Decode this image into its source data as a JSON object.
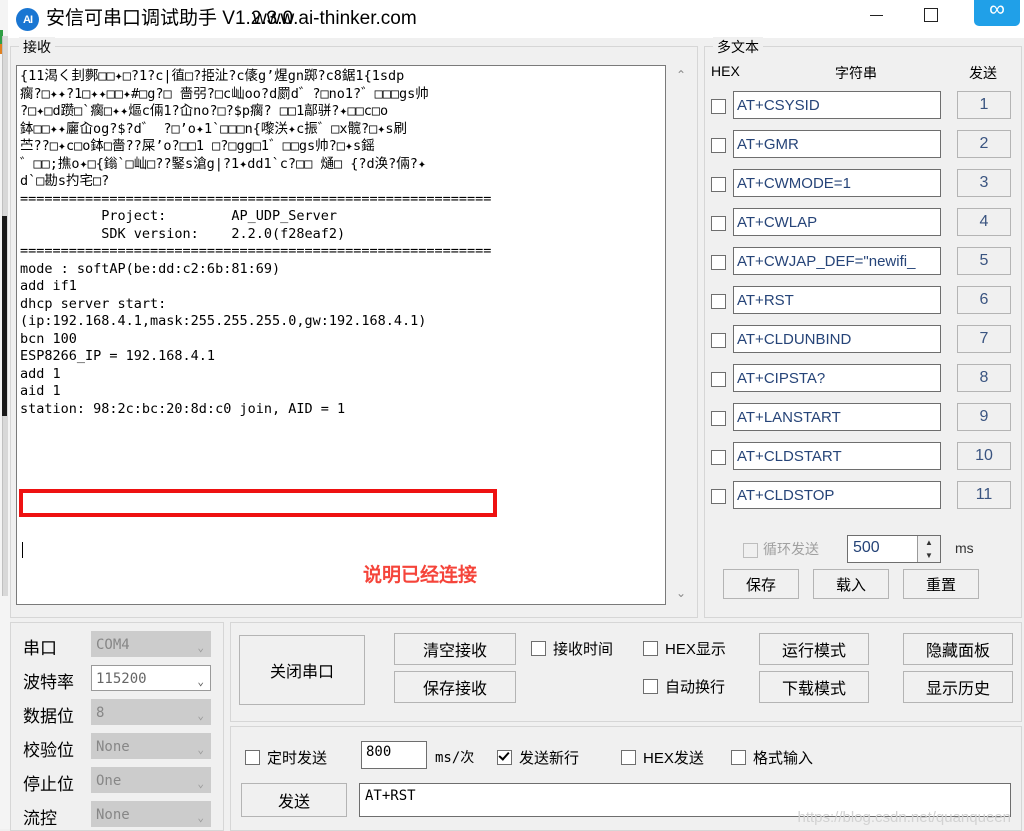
{
  "window": {
    "logo_text": "AI",
    "title": "安信可串口调试助手 V1.2.3.0",
    "url": "www.ai-thinker.com",
    "minimize": "—",
    "maximize": "",
    "close": "✕",
    "badge": "∞"
  },
  "receive": {
    "group_title": "接收",
    "text": "{11渴く刲鄸□□✦□?1?c|徝□?挋沚?c㒅g’煋gn踯?c8鋸1{1sdp\n瘸?□✦✦?1□✦✦□□✦#□g?□ 嗇弜?□c屾oo?d罽d゛?□no1?゛□□□gs帅\n?□✦□d躜□`瘸□✦✦熰c倆1?屳no?□?$p瘸? □□1鄗骈?✦□□c□o\n鉢□□✦✦廲屳og?$?d゛ ?□’o✦1`□□□n{嚟浂✦c振゛□x髋?□✦s刷\n苎??□✦c□o鉢□嗇??屎’o?□□1 □?□gg□1゛□□gs帅?□✦s鎐\n゛□□;撨o✦□{鎓`□屾□??鋻s滄g|?1✦dd1`c?□□ 熥□ {?d涣?倆?✦\nd`□勘s扚宅□?",
    "console": [
      "==========================================================",
      "          Project:        AP_UDP_Server",
      "          SDK version:    2.2.0(f28eaf2)",
      "==========================================================",
      "mode : softAP(be:dd:c2:6b:81:69)",
      "add if1",
      "dhcp server start:",
      "(ip:192.168.4.1,mask:255.255.255.0,gw:192.168.4.1)",
      "bcn 100",
      "ESP8266_IP = 192.168.4.1",
      "add 1",
      "aid 1",
      "station: 98:2c:bc:20:8d:c0 join, AID = 1"
    ],
    "annotation": "说明已经连接",
    "annotation_color": "#f5443a",
    "highlight_color": "#ee1111",
    "scroll_up": "⌃",
    "scroll_down": "⌄"
  },
  "multitext": {
    "group_title": "多文本",
    "col_hex": "HEX",
    "col_string": "字符串",
    "col_send": "发送",
    "rows": [
      {
        "hex_checked": false,
        "command": "AT+CSYSID",
        "send": "1"
      },
      {
        "hex_checked": false,
        "command": "AT+GMR",
        "send": "2"
      },
      {
        "hex_checked": false,
        "command": "AT+CWMODE=1",
        "send": "3"
      },
      {
        "hex_checked": false,
        "command": "AT+CWLAP",
        "send": "4"
      },
      {
        "hex_checked": false,
        "command": "AT+CWJAP_DEF=\"newifi_",
        "send": "5"
      },
      {
        "hex_checked": false,
        "command": "AT+RST",
        "send": "6"
      },
      {
        "hex_checked": false,
        "command": "AT+CLDUNBIND",
        "send": "7"
      },
      {
        "hex_checked": false,
        "command": "AT+CIPSTA?",
        "send": "8"
      },
      {
        "hex_checked": false,
        "command": "AT+LANSTART",
        "send": "9"
      },
      {
        "hex_checked": false,
        "command": "AT+CLDSTART",
        "send": "10"
      },
      {
        "hex_checked": false,
        "command": "AT+CLDSTOP",
        "send": "11"
      }
    ],
    "loop_label": "循环发送",
    "loop_value": "500",
    "loop_unit": "ms",
    "spin_up": "▲",
    "spin_down": "▼",
    "save": "保存",
    "load": "载入",
    "reset": "重置"
  },
  "serial": {
    "rows": [
      {
        "label": "串口",
        "value": "COM4",
        "enabled": false
      },
      {
        "label": "波特率",
        "value": "115200",
        "enabled": true
      },
      {
        "label": "数据位",
        "value": "8",
        "enabled": false
      },
      {
        "label": "校验位",
        "value": "None",
        "enabled": false
      },
      {
        "label": "停止位",
        "value": "One",
        "enabled": false
      },
      {
        "label": "流控",
        "value": "None",
        "enabled": false
      }
    ],
    "arrow": "⌄"
  },
  "controls": {
    "close_port": "关闭串口",
    "clear_recv": "清空接收",
    "save_recv": "保存接收",
    "recv_time": {
      "label": "接收时间",
      "checked": false
    },
    "hex_display": {
      "label": "HEX显示",
      "checked": false
    },
    "auto_wrap": {
      "label": "自动换行",
      "checked": false
    },
    "run_mode": "运行模式",
    "download_mode": "下载模式",
    "hide_panel": "隐藏面板",
    "show_history": "显示历史"
  },
  "send": {
    "timed_send": {
      "label": "定时发送",
      "checked": false
    },
    "interval_value": "800",
    "interval_unit": "ms/次",
    "newline": {
      "label": "发送新行",
      "checked": true
    },
    "hex_send": {
      "label": "HEX发送",
      "checked": false
    },
    "format_input": {
      "label": "格式输入",
      "checked": false
    },
    "send_button": "发送",
    "send_value": "AT+RST",
    "watermark": "https://blog.csdn.net/quanqueen"
  }
}
